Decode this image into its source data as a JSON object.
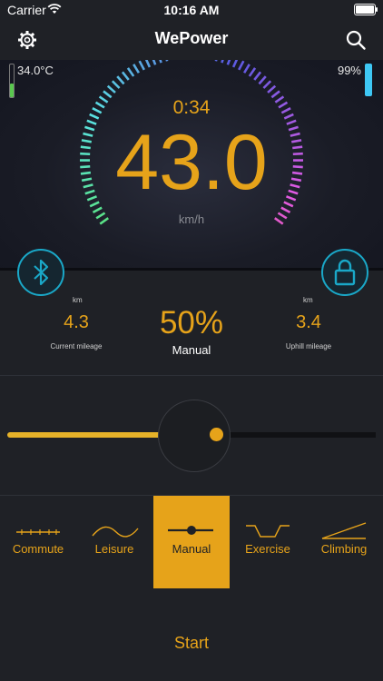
{
  "status_bar": {
    "carrier": "Carrier",
    "time": "10:16 AM"
  },
  "nav": {
    "title": "WePower"
  },
  "gauge": {
    "temperature": "34.0°C",
    "temperature_level": 0.4,
    "battery": "99%",
    "battery_level": 0.99,
    "timer": "0:34",
    "speed": "43.0",
    "speed_unit": "km/h"
  },
  "stats": {
    "current": {
      "unit": "km",
      "value": "4.3",
      "label": "Current mileage"
    },
    "percent": "50%",
    "mode": "Manual",
    "uphill": {
      "unit": "km",
      "value": "3.4",
      "label": "Uphill mileage"
    }
  },
  "slider": {
    "level": 0.5
  },
  "modes": [
    {
      "label": "Commute",
      "icon": "commute-icon"
    },
    {
      "label": "Leisure",
      "icon": "leisure-icon"
    },
    {
      "label": "Manual",
      "icon": "manual-icon",
      "active": true
    },
    {
      "label": "Exercise",
      "icon": "exercise-icon"
    },
    {
      "label": "Climbing",
      "icon": "climbing-icon"
    }
  ],
  "start_label": "Start",
  "colors": {
    "accent": "#e6a31a",
    "bluetooth": "#1aa8c8",
    "battery": "#3ec8f5",
    "background": "#1f2126"
  }
}
